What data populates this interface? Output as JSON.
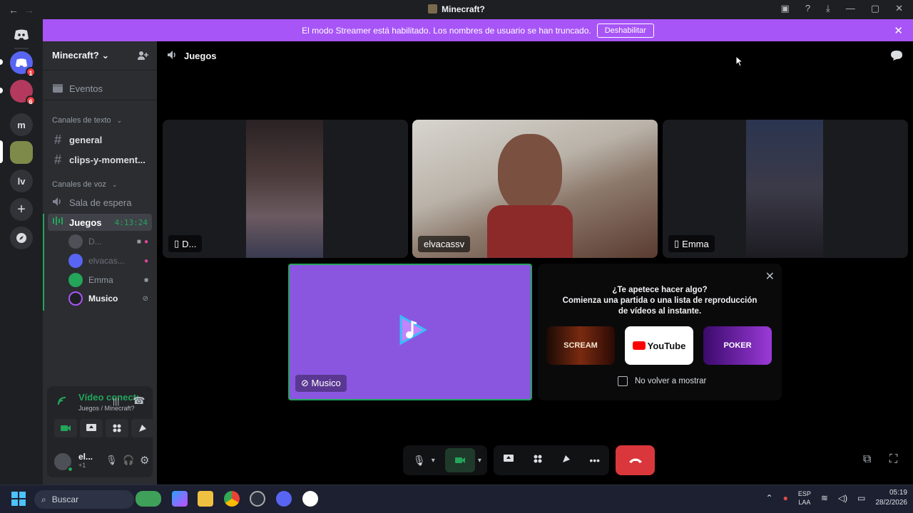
{
  "window": {
    "title": "Minecraft?",
    "back": "←",
    "forward": "→"
  },
  "rail": {
    "servers": [
      {
        "name": "discord-home",
        "label": "",
        "badge": ""
      },
      {
        "name": "dm",
        "label": "",
        "badge": "1"
      },
      {
        "name": "server-2",
        "label": "",
        "badge": "6"
      },
      {
        "name": "server-m",
        "label": "m",
        "badge": ""
      },
      {
        "name": "server-minecraft",
        "label": "",
        "badge": ""
      },
      {
        "name": "server-lv",
        "label": "lv",
        "badge": ""
      },
      {
        "name": "add-server",
        "label": "+",
        "badge": ""
      },
      {
        "name": "explore",
        "label": "",
        "badge": ""
      }
    ]
  },
  "banner": {
    "text": "El modo Streamer está habilitado. Los nombres de usuario se han truncado.",
    "button": "Deshabilitar",
    "close": "✕"
  },
  "sidebar": {
    "server_name": "Minecraft?",
    "chevron": "⌄",
    "events": "Eventos",
    "text_category": "Canales de texto",
    "text_channels": [
      "general",
      "clips-y-moment..."
    ],
    "voice_category": "Canales de voz",
    "waiting_room": "Sala de espera",
    "active_voice": {
      "name": "Juegos",
      "timer": "4:13:24"
    },
    "voice_users": [
      {
        "name": "D...",
        "dim": true
      },
      {
        "name": "elvacas...",
        "dim": true
      },
      {
        "name": "Emma",
        "dim": false
      },
      {
        "name": "Musico",
        "dim": false
      }
    ]
  },
  "voice_panel": {
    "status": "Vídeo conectado",
    "sub": "Juegos / Minecraft?"
  },
  "user": {
    "name": "el...",
    "status": "+1"
  },
  "main": {
    "channel": "Juegos",
    "tiles": [
      {
        "label": "D..."
      },
      {
        "label": "elvacassv"
      },
      {
        "label": "Emma"
      }
    ],
    "musico_label": "Musico"
  },
  "activity": {
    "title_line1": "¿Te apetece hacer algo?",
    "title_line2": "Comienza una partida o una lista de reproducción de vídeos al instante.",
    "cards": [
      "SCREAM",
      "YouTube",
      "POKER"
    ],
    "dont_show": "No volver a mostrar"
  },
  "taskbar": {
    "search": "Buscar",
    "lang1": "ESP",
    "lang2": "LAA",
    "time": "05:19",
    "date": "28/2/2026"
  },
  "colors": {
    "accent": "#a855f7",
    "green": "#23a55a",
    "red": "#da373c",
    "blurple": "#5865f2"
  }
}
